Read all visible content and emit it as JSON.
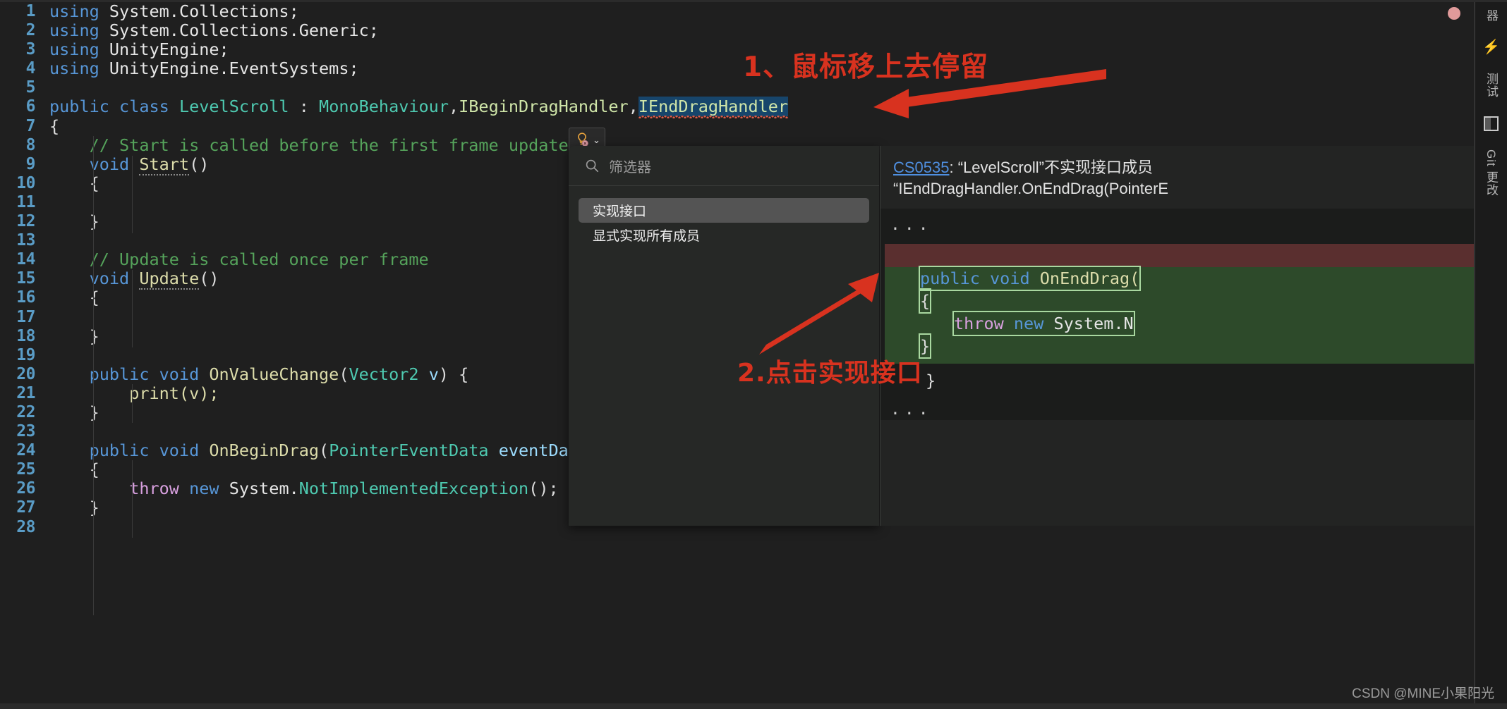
{
  "editor": {
    "language": "csharp",
    "line_numbers": [
      "1",
      "2",
      "3",
      "4",
      "5",
      "6",
      "7",
      "8",
      "9",
      "10",
      "11",
      "12",
      "13",
      "14",
      "15",
      "16",
      "17",
      "18",
      "19",
      "20",
      "21",
      "22",
      "23",
      "24",
      "25",
      "26",
      "27",
      "28"
    ],
    "lines": [
      {
        "n": "1",
        "text": "using System.Collections;"
      },
      {
        "n": "2",
        "text": "using System.Collections.Generic;"
      },
      {
        "n": "3",
        "text": "using UnityEngine;"
      },
      {
        "n": "4",
        "text": "using UnityEngine.EventSystems;"
      },
      {
        "n": "5",
        "text": ""
      },
      {
        "n": "6",
        "text": "public class LevelScroll : MonoBehaviour,IBeginDragHandler,IEndDragHandler"
      },
      {
        "n": "7",
        "text": "{"
      },
      {
        "n": "8",
        "text": "    // Start is called before the first frame update"
      },
      {
        "n": "9",
        "text": "    void Start()"
      },
      {
        "n": "10",
        "text": "    {"
      },
      {
        "n": "11",
        "text": ""
      },
      {
        "n": "12",
        "text": "    }"
      },
      {
        "n": "13",
        "text": ""
      },
      {
        "n": "14",
        "text": "    // Update is called once per frame"
      },
      {
        "n": "15",
        "text": "    void Update()"
      },
      {
        "n": "16",
        "text": "    {"
      },
      {
        "n": "17",
        "text": ""
      },
      {
        "n": "18",
        "text": "    }"
      },
      {
        "n": "19",
        "text": ""
      },
      {
        "n": "20",
        "text": "    public void OnValueChange(Vector2 v) {"
      },
      {
        "n": "21",
        "text": "        print(v);"
      },
      {
        "n": "22",
        "text": "    }"
      },
      {
        "n": "23",
        "text": ""
      },
      {
        "n": "24",
        "text": "    public void OnBeginDrag(PointerEventData eventData)"
      },
      {
        "n": "25",
        "text": "    {"
      },
      {
        "n": "26",
        "text": "        throw new System.NotImplementedException();"
      },
      {
        "n": "27",
        "text": "    }"
      },
      {
        "n": "28",
        "text": ""
      }
    ],
    "tokens": {
      "using": "using",
      "ns_collections": "System.Collections;",
      "ns_generic": "System.Collections.Generic;",
      "ns_unity": "UnityEngine;",
      "ns_unity_events": "UnityEngine.EventSystems;",
      "public": "public",
      "class": "class",
      "class_name": "LevelScroll",
      "colon": " : ",
      "base": "MonoBehaviour",
      "iface_begin": "IBeginDragHandler",
      "iface_end": "IEndDragHandler",
      "comment_start": "// Start is called before the first frame update",
      "comment_update": "// Update is called once per frame",
      "void": "void",
      "start": "Start",
      "update": "Update",
      "onvaluechange": "OnValueChange",
      "vector2": "Vector2",
      "v": "v",
      "print": "print(v);",
      "onbegindrag": "OnBeginDrag",
      "pointereventdata": "PointerEventData",
      "eventdata": "eventData",
      "throw": "throw",
      "new": "new",
      "system": "System.",
      "notimpl": "NotImplementedException",
      "parens": "();",
      "brace_open": "{",
      "brace_close": "}"
    },
    "selected_text": "IEndDragHandler",
    "error_squiggle_on": "IEndDragHandler"
  },
  "quickfix_button": {
    "icon": "lightbulb-error-icon",
    "chevron": "⌄"
  },
  "popup": {
    "search": {
      "placeholder": "筛选器",
      "value": "",
      "icon": "search-icon"
    },
    "items": [
      {
        "label": "实现接口",
        "selected": true
      },
      {
        "label": "显式实现所有成员",
        "selected": false
      }
    ]
  },
  "preview": {
    "error_code": "CS0535",
    "error_text_1": ": “LevelScroll”不实现接口成员",
    "error_text_2": "“IEndDragHandler.OnEndDrag(PointerE",
    "ellipsis_top": "...",
    "ellipsis_bottom": "...",
    "code": {
      "signature_kw": "public void ",
      "signature_name": "OnEndDrag(",
      "brace_open": "{",
      "throw_kw": "throw",
      "new_kw": "new",
      "system": "System.N",
      "brace_close": "}",
      "outer_close": "}"
    }
  },
  "activity_bar": {
    "items": [
      {
        "label": "器",
        "type": "vlabel",
        "name": "resource-manager-label"
      },
      {
        "label": "⚡",
        "type": "icon",
        "name": "lightning-icon"
      },
      {
        "label": "测试",
        "type": "vlabel",
        "name": "test-label"
      },
      {
        "label": "panel",
        "type": "square",
        "name": "panel-layout-icon"
      },
      {
        "label": "Git 更改",
        "type": "vlabel",
        "name": "git-changes-label"
      }
    ]
  },
  "annotations": [
    {
      "id": "anno1",
      "text": "1、鼠标移上去停留",
      "color": "#d8321f"
    },
    {
      "id": "anno2",
      "text": "2.点击实现接口",
      "color": "#d8321f"
    }
  ],
  "watermark": "CSDN @MINE小果阳光",
  "colors": {
    "editor_bg": "#1f1f1f",
    "popup_bg": "#262826",
    "preview_bg": "#232423",
    "selection": "#17456b",
    "annotation_red": "#d8321f",
    "added_line": "#2d4a2a",
    "removed_line": "#5a2f2f",
    "line_number": "#5a9cc6"
  }
}
